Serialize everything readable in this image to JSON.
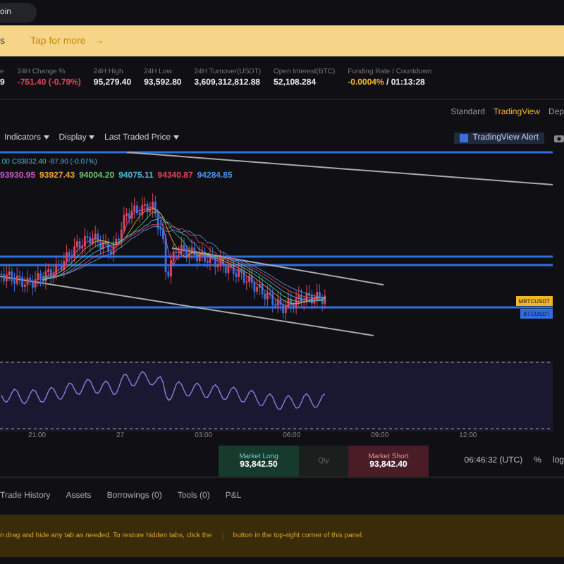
{
  "search": {
    "value": "oin"
  },
  "banner": {
    "lead": "s",
    "text": "Tap for more",
    "arrow": "→"
  },
  "stats": [
    {
      "label": "e",
      "value": "9",
      "color": "#eeeeee"
    },
    {
      "label": "24H Change %",
      "value": "-751.40 (-0.79%)",
      "color": "#e0455a"
    },
    {
      "label": "24H High",
      "value": "95,279.40",
      "color": "#eeeeee"
    },
    {
      "label": "24H Low",
      "value": "93,592.80",
      "color": "#eeeeee"
    },
    {
      "label": "24H Turnover(USDT)",
      "value": "3,609,312,812.88",
      "color": "#eeeeee"
    },
    {
      "label": "Open Interest(BTC)",
      "value": "52,108.284",
      "color": "#eeeeee"
    },
    {
      "label": "Funding Rate / Countdown",
      "value": "-0.0004%",
      "extra": "/ 01:13:28",
      "color": "#f0b429"
    }
  ],
  "view_tabs": [
    {
      "label": "Standard",
      "selected": false
    },
    {
      "label": "TradingView",
      "selected": true
    },
    {
      "label": "Dep",
      "selected": false
    }
  ],
  "toolbar": {
    "items": [
      "Indicators",
      "Display",
      "Last Traded Price"
    ],
    "alert": "TradingView Alert"
  },
  "legend": {
    "ohlc": ".00 C93832.40 -87.90 (-0.07%)",
    "ma": [
      {
        "value": "93930.95",
        "color": "#c05bc4"
      },
      {
        "value": "93927.43",
        "color": "#e8a33a"
      },
      {
        "value": "94004.20",
        "color": "#6bc46b"
      },
      {
        "value": "94075.11",
        "color": "#4fb3d6"
      },
      {
        "value": "94340.87",
        "color": "#e0455a"
      },
      {
        "value": "94284.85",
        "color": "#4f8fe0"
      }
    ]
  },
  "price_tags": [
    {
      "label": "MBTCUSDT",
      "color": "#f0b429"
    },
    {
      "label": "BTCUSDT",
      "color": "#2f6fe0"
    }
  ],
  "time_axis": [
    "21:00",
    "27",
    "03:00",
    "06:00",
    "09:00",
    "12:00"
  ],
  "order": {
    "long_label": "Market Long",
    "long_price": "93,842.50",
    "qty": "Qty",
    "short_label": "Market Short",
    "short_price": "93,842.40"
  },
  "clock": "06:46:32 (UTC)",
  "scale_options": [
    "%",
    "log"
  ],
  "bottom_tabs": [
    "Trade History",
    "Assets",
    "Borrowings (0)",
    "Tools (0)",
    "P&L"
  ],
  "notice": {
    "before": "n drag and hide any tab as needed. To restore hidden tabs, click the",
    "icon": "⋮",
    "after": "button in the top-right corner of this panel."
  }
}
